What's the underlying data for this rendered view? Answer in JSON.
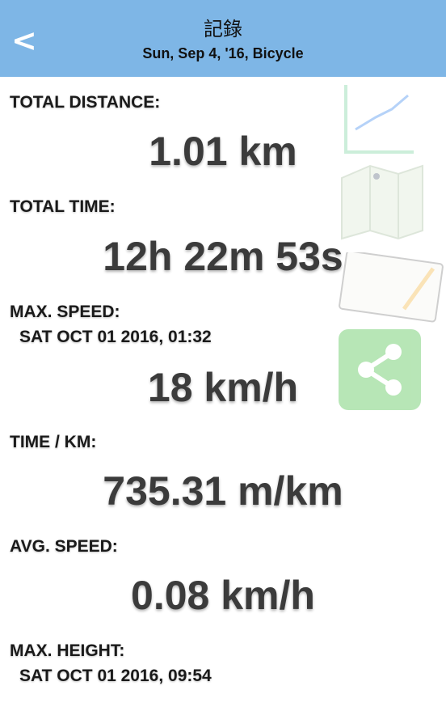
{
  "header": {
    "back_label": "<",
    "title": "記錄",
    "subtitle": "Sun, Sep 4, '16, Bicycle"
  },
  "stats": {
    "total_distance": {
      "label": "TOTAL DISTANCE:",
      "value": "1.01 km"
    },
    "total_time": {
      "label": "TOTAL TIME:",
      "value": "12h 22m 53s"
    },
    "max_speed": {
      "label": "MAX. SPEED:",
      "when": "SAT OCT 01  2016, 01:32",
      "value": "18 km/h"
    },
    "time_per_km": {
      "label": "TIME / KM:",
      "value": "735.31 m/km"
    },
    "avg_speed": {
      "label": "AVG. SPEED:",
      "value": "0.08 km/h"
    },
    "max_height": {
      "label": "MAX. HEIGHT:",
      "when": "SAT OCT 01  2016, 09:54"
    }
  },
  "side_icons": [
    "chart-icon",
    "map-icon",
    "notebook-icon",
    "share-icon"
  ],
  "colors": {
    "header": "#7eb6e6",
    "share": "#a6e0a5",
    "value_text": "#3b3b3b"
  }
}
